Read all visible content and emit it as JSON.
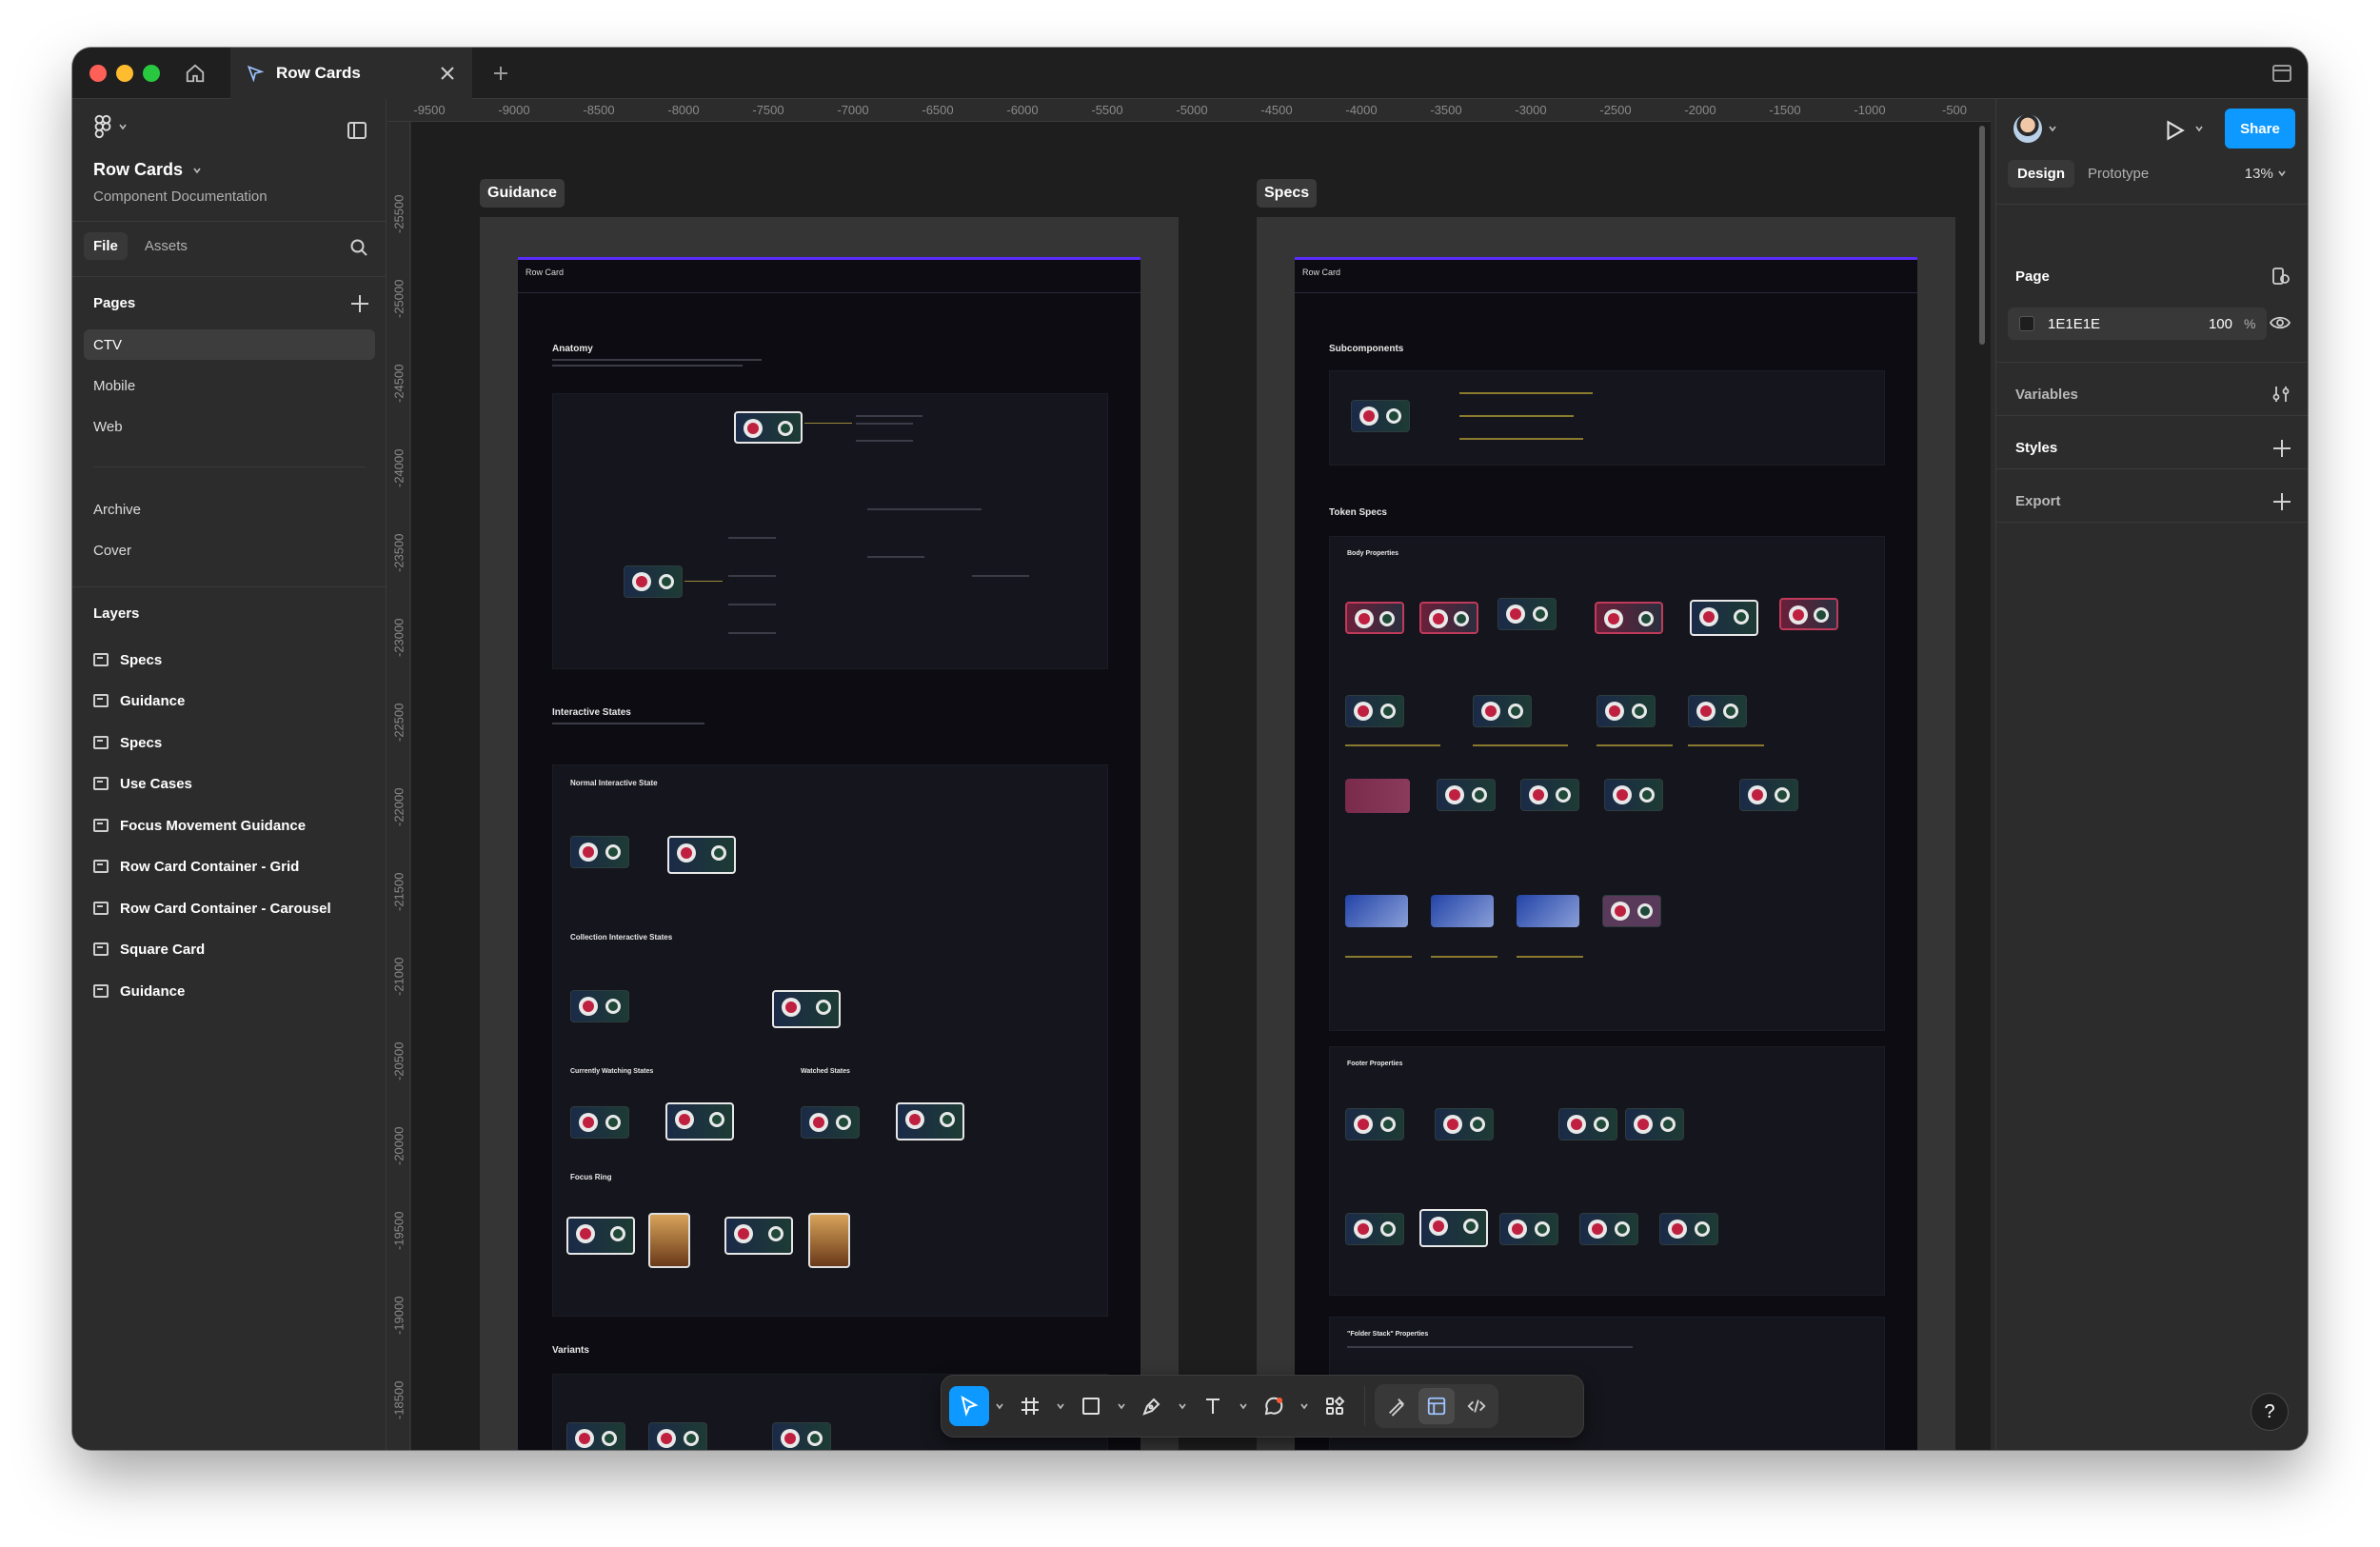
{
  "tab": {
    "title": "Row Cards"
  },
  "file": {
    "name": "Row Cards",
    "subtitle": "Component Documentation"
  },
  "left_tabs": {
    "file": "File",
    "assets": "Assets"
  },
  "pages": {
    "title": "Pages",
    "items": [
      "CTV",
      "Mobile",
      "Web",
      "Archive",
      "Cover"
    ],
    "active": "CTV"
  },
  "layers": {
    "title": "Layers",
    "items": [
      "Specs",
      "Guidance",
      "Specs",
      "Use Cases",
      "Focus Movement Guidance",
      "Row Card Container - Grid",
      "Row Card Container - Carousel",
      "Square Card",
      "Guidance"
    ]
  },
  "ruler_top": [
    "-9500",
    "-9000",
    "-8500",
    "-8000",
    "-7500",
    "-7000",
    "-6500",
    "-6000",
    "-5500",
    "-5000",
    "-4500",
    "-4000",
    "-3500",
    "-3000",
    "-2500",
    "-2000",
    "-1500",
    "-1000",
    "-500"
  ],
  "ruler_left": [
    "-25500",
    "-25000",
    "-24500",
    "-24000",
    "-23500",
    "-23000",
    "-22500",
    "-22000",
    "-21500",
    "-21000",
    "-20500",
    "-20000",
    "-19500",
    "-19000",
    "-18500"
  ],
  "canvas": {
    "guidance_label": "Guidance",
    "specs_label": "Specs",
    "guidance_doc": {
      "header": "Row Card",
      "sections": [
        "Anatomy",
        "Interactive States",
        "Variants"
      ],
      "subsections": [
        "Normal Interactive State",
        "Collection Interactive States",
        "Currently Watching States",
        "Watched States",
        "Focus Ring"
      ]
    },
    "specs_doc": {
      "header": "Row Card",
      "sections": [
        "Subcomponents",
        "Token Specs"
      ],
      "subsections": [
        "Body Properties",
        "Footer Properties",
        "\"Folder Stack\" Properties"
      ]
    }
  },
  "right_panel": {
    "share": "Share",
    "tabs": {
      "design": "Design",
      "prototype": "Prototype"
    },
    "zoom": "13%",
    "page_section": "Page",
    "page_color": "1E1E1E",
    "page_opacity": "100",
    "percent": "%",
    "variables": "Variables",
    "styles": "Styles",
    "export": "Export"
  },
  "help": "?",
  "colors": {
    "accent": "#0d99ff",
    "canvas": "#1e1e1e",
    "panel": "#2c2c2c",
    "doc_accent": "#5b2cff"
  }
}
